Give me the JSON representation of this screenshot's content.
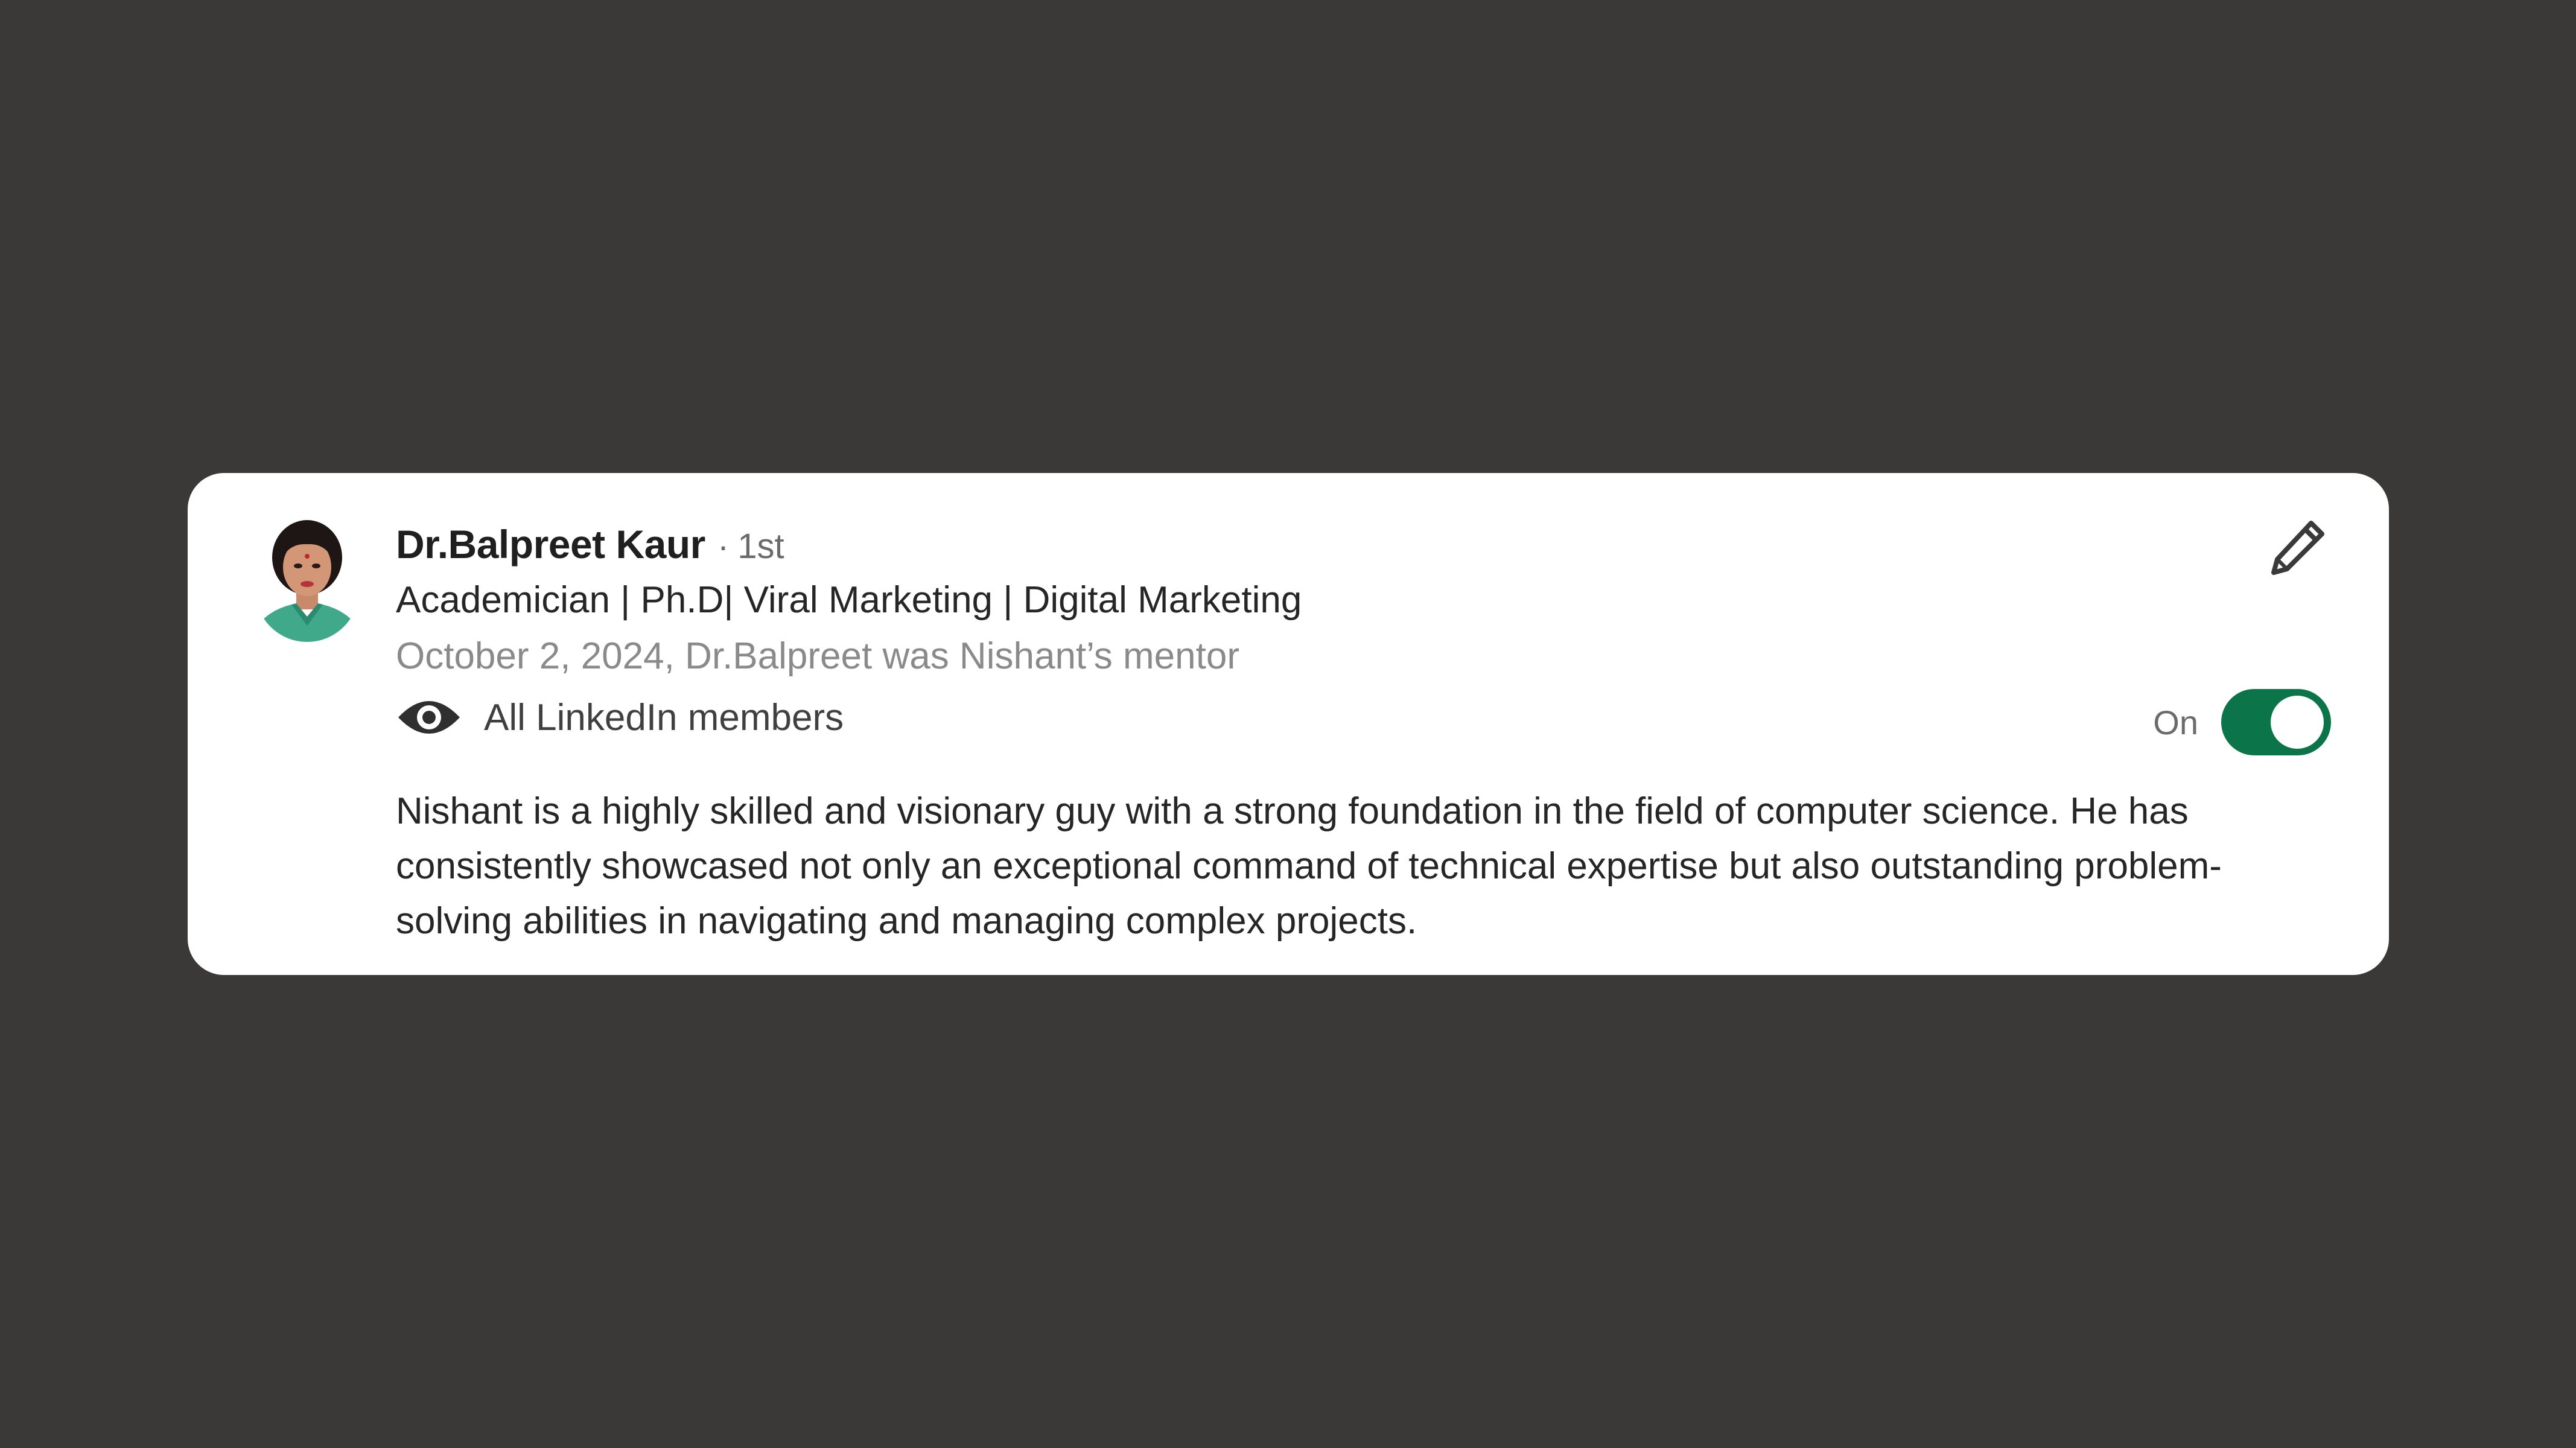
{
  "recommendation": {
    "author_name": "Dr.Balpreet Kaur",
    "separator": "·",
    "connection_degree": "1st",
    "headline": "Academician | Ph.D| Viral Marketing | Digital Marketing",
    "meta": "October 2, 2024, Dr.Balpreet was Nishant’s mentor",
    "visibility_label": "All LinkedIn members",
    "visibility_icon": "eye-icon",
    "toggle_label": "On",
    "toggle_state": true,
    "edit_icon": "pencil-icon",
    "body": "Nishant is a highly skilled and visionary guy with a strong foundation in the field of computer science. He has consistently showcased not only an exceptional command of technical expertise but also outstanding problem-solving abilities in navigating and managing complex projects."
  },
  "colors": {
    "background": "#3a3938",
    "card": "#ffffff",
    "toggle_on": "#0b7448",
    "text_primary": "#1f1f1f",
    "text_secondary": "#8a8a8a"
  }
}
